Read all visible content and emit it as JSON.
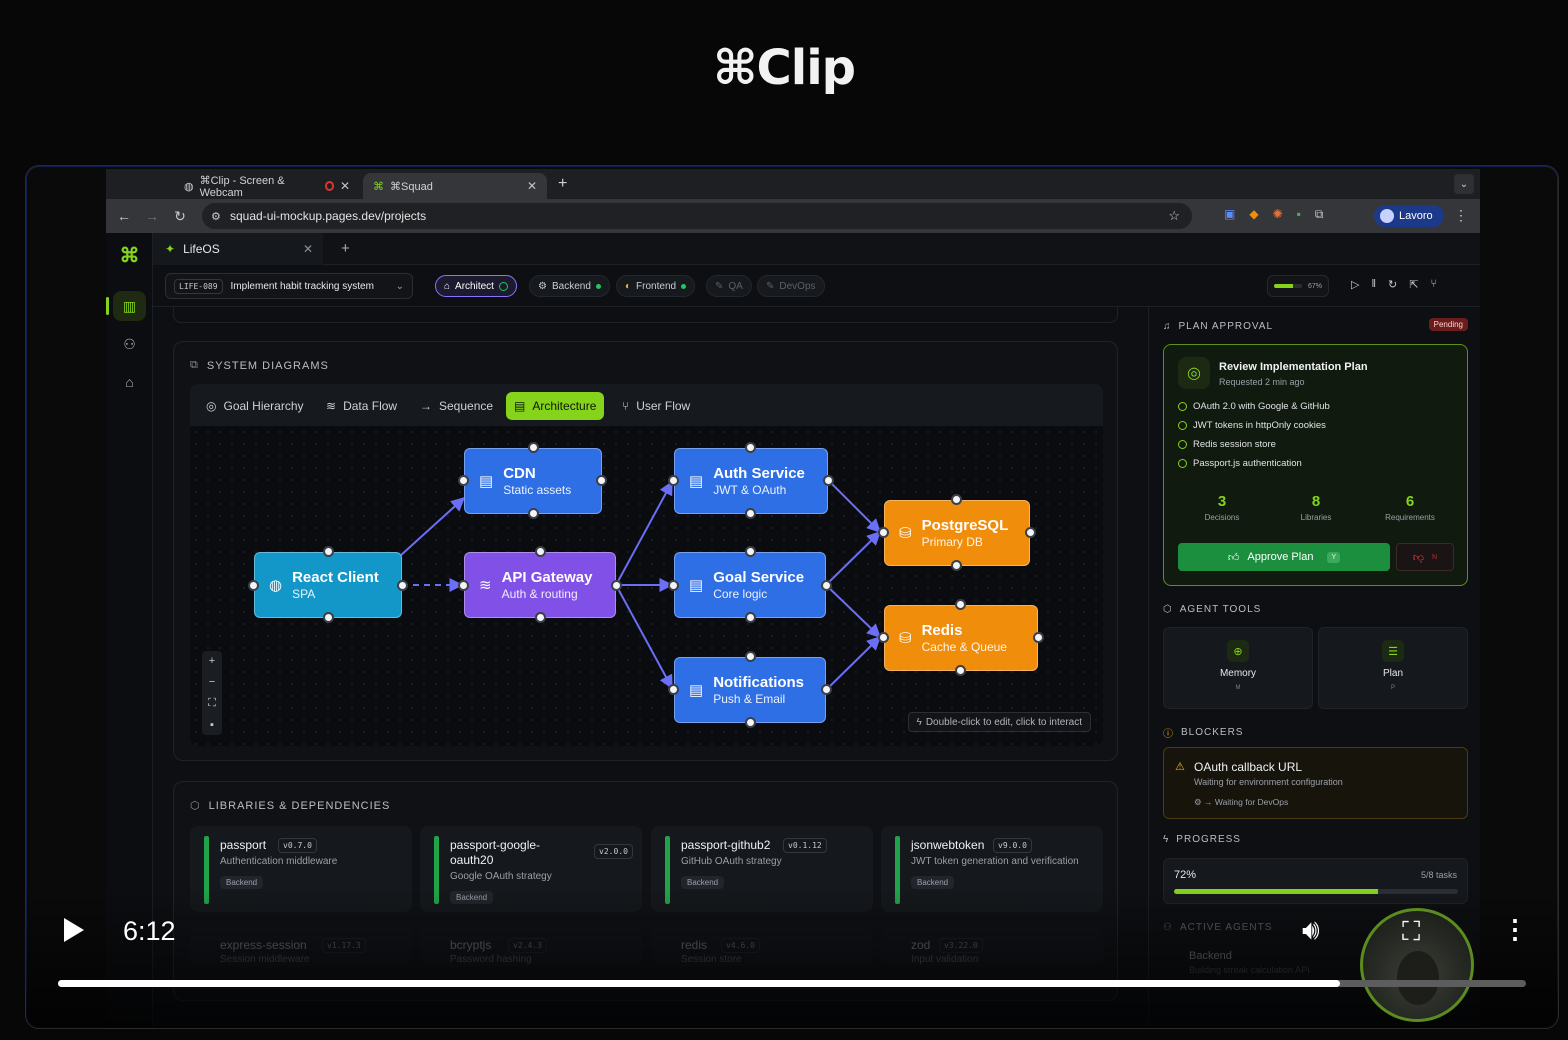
{
  "brand": {
    "title": "⌘Clip"
  },
  "browser": {
    "tabs": [
      {
        "label": "⌘Clip - Screen & Webcam"
      },
      {
        "label": "⌘Squad"
      }
    ],
    "url": "squad-ui-mockup.pages.dev/projects",
    "profile": "Lavoro"
  },
  "app": {
    "tab_label": "LifeOS",
    "issue_key": "LIFE-089",
    "issue_title": "Implement habit tracking system",
    "agents": [
      {
        "label": "Architect",
        "state": "active"
      },
      {
        "label": "Backend",
        "state": "online"
      },
      {
        "label": "Frontend",
        "state": "online"
      },
      {
        "label": "QA",
        "state": "disabled"
      },
      {
        "label": "DevOps",
        "state": "disabled"
      }
    ],
    "progress_percent_label": "67%",
    "progress_fraction": 0.67
  },
  "diagrams": {
    "title": "SYSTEM DIAGRAMS",
    "tabs": [
      "Goal Hierarchy",
      "Data Flow",
      "Sequence",
      "Architecture",
      "User Flow"
    ],
    "active_tab": "Architecture",
    "nodes": {
      "cdn": {
        "title": "CDN",
        "sub": "Static assets"
      },
      "react": {
        "title": "React Client",
        "sub": "SPA"
      },
      "gateway": {
        "title": "API Gateway",
        "sub": "Auth & routing"
      },
      "auth": {
        "title": "Auth Service",
        "sub": "JWT & OAuth"
      },
      "goal": {
        "title": "Goal Service",
        "sub": "Core logic"
      },
      "notif": {
        "title": "Notifications",
        "sub": "Push & Email"
      },
      "pg": {
        "title": "PostgreSQL",
        "sub": "Primary DB"
      },
      "redis": {
        "title": "Redis",
        "sub": "Cache & Queue"
      }
    },
    "hint": "Double-click to edit, click to interact"
  },
  "libraries": {
    "title": "LIBRARIES & DEPENDENCIES",
    "items": [
      {
        "name": "passport",
        "version": "v0.7.0",
        "desc": "Authentication middleware",
        "tag": "Backend"
      },
      {
        "name": "passport-google-oauth20",
        "version": "v2.0.0",
        "desc": "Google OAuth strategy",
        "tag": "Backend"
      },
      {
        "name": "passport-github2",
        "version": "v0.1.12",
        "desc": "GitHub OAuth strategy",
        "tag": "Backend"
      },
      {
        "name": "jsonwebtoken",
        "version": "v9.0.0",
        "desc": "JWT token generation and verification",
        "tag": "Backend"
      },
      {
        "name": "express-session",
        "version": "v1.17.3",
        "desc": "Session middleware"
      },
      {
        "name": "bcryptjs",
        "version": "v2.4.3",
        "desc": "Password hashing"
      },
      {
        "name": "redis",
        "version": "v4.6.0",
        "desc": "Session store"
      },
      {
        "name": "zod",
        "version": "v3.22.0",
        "desc": "Input validation"
      }
    ]
  },
  "plan": {
    "section": "PLAN APPROVAL",
    "status": "Pending",
    "title": "Review Implementation Plan",
    "requested": "Requested 2 min ago",
    "items": [
      "OAuth 2.0 with Google & GitHub",
      "JWT tokens in httpOnly cookies",
      "Redis session store",
      "Passport.js authentication"
    ],
    "stats": [
      {
        "value": "3",
        "label": "Decisions"
      },
      {
        "value": "8",
        "label": "Libraries"
      },
      {
        "value": "6",
        "label": "Requirements"
      }
    ],
    "approve_label": "Approve Plan",
    "approve_key": "Y",
    "reject_key": "N"
  },
  "tools": {
    "section": "AGENT TOOLS",
    "items": [
      {
        "label": "Memory",
        "key": "M"
      },
      {
        "label": "Plan",
        "key": "P"
      }
    ]
  },
  "blockers": {
    "section": "BLOCKERS",
    "title": "OAuth callback URL",
    "desc": "Waiting for environment configuration",
    "waiting": "Waiting for DevOps"
  },
  "progress": {
    "section": "PROGRESS",
    "percent_label": "72%",
    "tasks": "5/8 tasks",
    "fraction": 0.72
  },
  "active_agents": {
    "section": "ACTIVE AGENTS",
    "first_name": "Backend",
    "first_desc": "Building streak calculation API"
  },
  "video": {
    "time": "6:12",
    "progress_fraction": 0.873
  },
  "colors": {
    "accent": "#86d31c",
    "node_blue": "#2f6fe6",
    "node_teal": "#1297c8",
    "node_purple": "#8150e6",
    "node_orange": "#f08e0b"
  }
}
